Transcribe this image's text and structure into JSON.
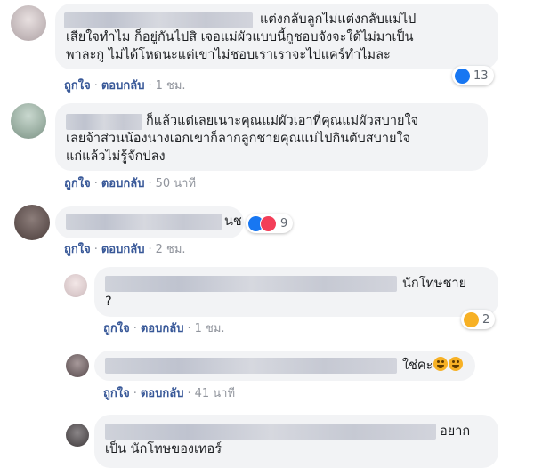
{
  "actions": {
    "like": "ถูกใจ",
    "reply": "ตอบกลับ",
    "separator": "·"
  },
  "comments": [
    {
      "lines": [
        "แต่งกลับลูกไม่แต่งกลับแม่ไป",
        "เสียใจทำไม ก็อยู่กันไปสิ เจอแม่ผัวแบบนี้กูชอบจังจะใด้ไม่มาเป็น",
        "พาละกู ไม่ได้โหดนะแต่เขาไม่ชอบเราเราจะไปแคร์ทำไมละ"
      ],
      "time": "1 ชม.",
      "reaction": {
        "type": "like",
        "count": "13"
      }
    },
    {
      "lines": [
        "ก็แล้วแต่เลยเนาะคุณแม่ผัวเอาที่คุณแม่ผัวสบายใจ",
        "เลยจ้าส่วนน้องนางเอกเขาก็ลากลูกชายคุณแม่ไปกินตับสบายใจ",
        "แก่แล้วไม่รู้จักปลง"
      ],
      "time": "50 นาที"
    },
    {
      "lines": [
        "นช"
      ],
      "time": "2 ชม.",
      "reaction": {
        "type": "like-love",
        "count": "9"
      }
    }
  ],
  "replies": [
    {
      "lines": [
        "นักโทษชาย",
        "?"
      ],
      "time": "1 ชม.",
      "reaction": {
        "type": "haha",
        "count": "2"
      }
    },
    {
      "lines": [
        "ใช่คะ"
      ],
      "time": "41 นาที"
    },
    {
      "lines": [
        "อยาก",
        "เป็น นักโทษของเทอร์"
      ]
    }
  ],
  "colors": {
    "link": "#385898",
    "bubble": "#f2f3f5",
    "meta": "#90949c",
    "like": "#1877f2",
    "love": "#f33e58",
    "haha": "#f7b125"
  }
}
